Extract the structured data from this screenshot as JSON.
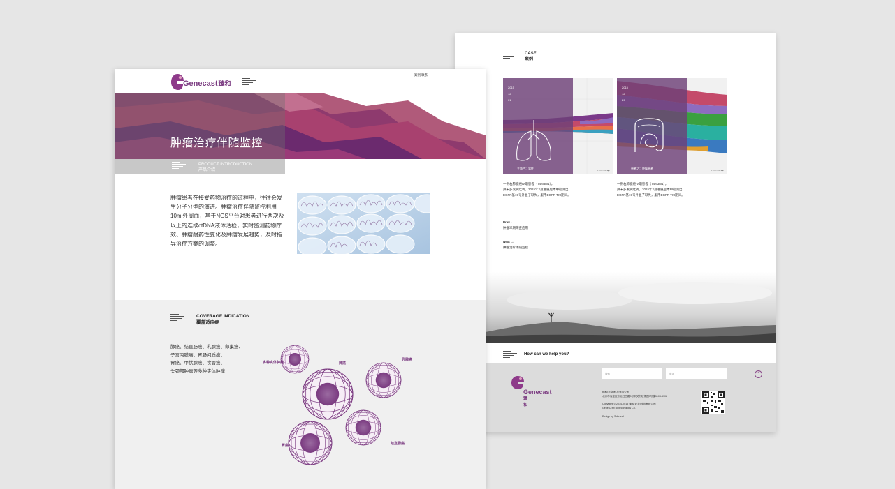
{
  "back_page": {
    "case_label": "CASE",
    "case_label_cn": "案例",
    "cards": [
      {
        "year": "2015",
        "month": "12",
        "day": "01",
        "caption": "主角色：男性",
        "corner": "PROFILE  ◀▶"
      },
      {
        "year": "2015",
        "month": "12",
        "day": "29",
        "caption": "患者之：肿瘤患者",
        "corner": "PROFILE  ◀▶"
      }
    ],
    "case_descriptions": [
      [
        "一例右肺腺癌IV期患者（T4N3M1），",
        "并未多发病灶转，2015年2月进展后本中检测出",
        "EGFR基19号外显子缺失，服用EGFR TKI期间。"
      ],
      [
        "一例右肺腺癌IV期患者（T4N3M1），",
        "并未多发病灶转，2015年2月进展后本中检测出",
        "EGFR基19号外显子缺失，服用EGFR TKI期间。"
      ]
    ],
    "prev_label": "Prev  ←",
    "prev_text": "肿瘤早期筛查应用",
    "next_label": "Next  →",
    "next_text": "肿瘤治疗伴随监控",
    "help_text": "How can we help you?",
    "footer": {
      "input1_placeholder": "搜索",
      "input2_placeholder": "电话",
      "brand": "Genecast",
      "brand_cn": "臻和",
      "company_lines": [
        "臻和(北京)科技有限公司",
        "北京市海淀区东北旺西路8号中关村软件园9号楼5103-5108"
      ],
      "copyright_lines": [
        "Copyright © 2014-2015 臻和(北京)科技有限公司",
        "Gene Crab Biotechnology Co."
      ],
      "design_line": "Design by Subrand",
      "up_icon": "up-arrow-icon"
    }
  },
  "front_page": {
    "brand": "Genecast",
    "brand_cn": "臻和",
    "header_links": "案例  联系",
    "banner_title": "肿瘤治疗伴随监控",
    "product_intro_en": "PRODUCT INTRODUCTION",
    "product_intro_cn": "产品介绍",
    "intro_text": "肿瘤患者在接受药物治疗的过程中，往往会发生分子分型的演进。肿瘤治疗伴随监控利用10ml外周血，基于NGS平台对患者进行两次及以上的连续ctDNA液体活检，实时监测药物疗效、肿瘤耐药性变化及肿瘤发展趋势，及时指导治疗方案的调整。",
    "coverage_title_en": "COVERAGE INDICATION",
    "coverage_title_cn": "覆盖适应症",
    "coverage_lines": [
      "肺癌、结直肠癌、乳腺癌、卵巢癌、",
      "子宫内膜癌、胃肠间质瘤、",
      "胃癌、甲状腺癌、食管癌、",
      "头颈部肿瘤等多种实体肿瘤"
    ],
    "sphere_labels": [
      "多种实体肿瘤",
      "肺癌",
      "乳腺癌",
      "胃癌",
      "结直肠癌"
    ]
  },
  "colors": {
    "accent": "#7a3a80",
    "banner_magenta": "#a8416f",
    "banner_purple": "#6b2a6e",
    "coverage_bg": "#f0f0f0"
  }
}
